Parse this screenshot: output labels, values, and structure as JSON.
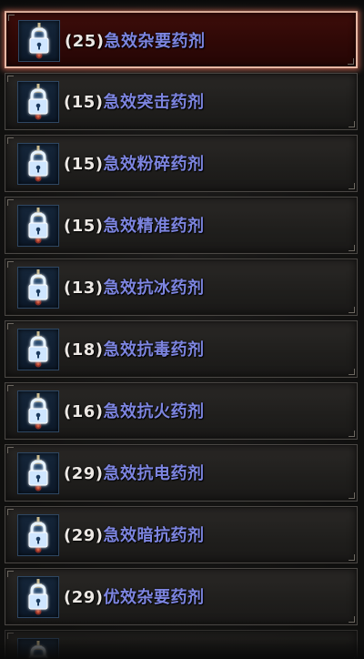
{
  "header": {
    "cut_off_text": "(25)"
  },
  "potions": [
    {
      "level": "(25)",
      "name": "急效杂要药剂",
      "selected": true
    },
    {
      "level": "(15)",
      "name": "急效突击药剂",
      "selected": false
    },
    {
      "level": "(15)",
      "name": "急效粉碎药剂",
      "selected": false
    },
    {
      "level": "(15)",
      "name": "急效精准药剂",
      "selected": false
    },
    {
      "level": "(13)",
      "name": "急效抗冰药剂",
      "selected": false
    },
    {
      "level": "(18)",
      "name": "急效抗毒药剂",
      "selected": false
    },
    {
      "level": "(16)",
      "name": "急效抗火药剂",
      "selected": false
    },
    {
      "level": "(29)",
      "name": "急效抗电药剂",
      "selected": false
    },
    {
      "level": "(29)",
      "name": "急效暗抗药剂",
      "selected": false
    },
    {
      "level": "(29)",
      "name": "优效杂要药剂",
      "selected": false
    }
  ],
  "icons": {
    "lock": "lock-icon",
    "potion": "potion-icon"
  },
  "colors": {
    "name_text": "#7d85e0",
    "level_text": "#ece8e4",
    "selected_border": "#e8b8a4",
    "selected_bg": "#3d0d0a"
  }
}
